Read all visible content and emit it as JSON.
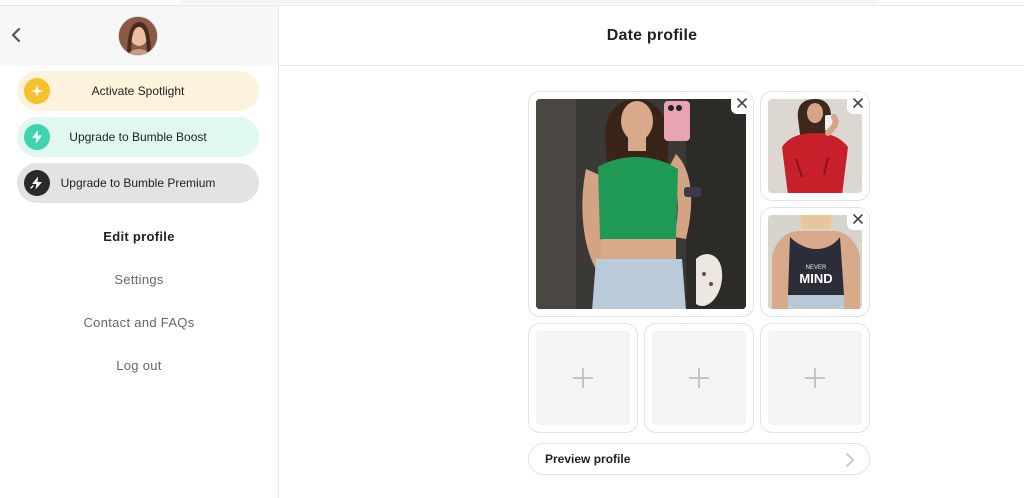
{
  "sidebar": {
    "spotlight_label": "Activate Spotlight",
    "boost_label": "Upgrade to Bumble Boost",
    "premium_label": "Upgrade to Bumble Premium",
    "menu": {
      "edit_profile": "Edit profile",
      "settings": "Settings",
      "contact": "Contact and FAQs",
      "logout": "Log out"
    }
  },
  "main": {
    "title": "Date profile",
    "preview_label": "Preview profile"
  },
  "photos": {
    "tee_text_top": "NEVER",
    "tee_text_bottom": "MIND"
  },
  "colors": {
    "spotlight": "#f6c12e",
    "boost": "#3fd3b0",
    "premium": "#2a2a2a"
  },
  "icons": {
    "back": "chevron-left-icon",
    "spotlight": "sparkle-icon",
    "boost": "lightning-icon",
    "premium": "lightning-circle-icon",
    "remove": "close-icon",
    "add": "plus-icon",
    "preview": "chevron-right-icon"
  }
}
